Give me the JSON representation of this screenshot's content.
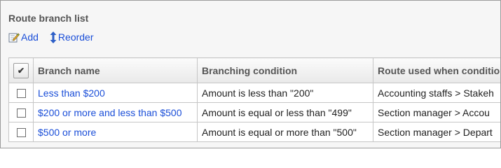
{
  "section": {
    "title": "Route branch list"
  },
  "toolbar": {
    "add_label": "Add",
    "add_icon": "add-edit-icon",
    "reorder_label": "Reorder",
    "reorder_icon": "up-down-arrow-icon"
  },
  "table": {
    "check_all_glyph": "✔",
    "headers": {
      "branch_name": "Branch name",
      "branching_condition": "Branching condition",
      "route_used": "Route used when condition"
    },
    "rows": [
      {
        "branch_name": "Less than $200",
        "condition": "Amount is less than \"200\"",
        "route": "Accounting staffs > Stakeh"
      },
      {
        "branch_name": "$200 or more and less than $500",
        "condition": "Amount is equal or less than \"499\"",
        "route": "Section manager > Accou"
      },
      {
        "branch_name": "$500 or more",
        "condition": "Amount is equal or more than \"500\"",
        "route": "Section manager > Depart"
      }
    ]
  },
  "colors": {
    "link": "#1a4ed8",
    "panel_background": "#f6f6f6",
    "header_text": "#555555",
    "border": "#c6c6c6"
  }
}
